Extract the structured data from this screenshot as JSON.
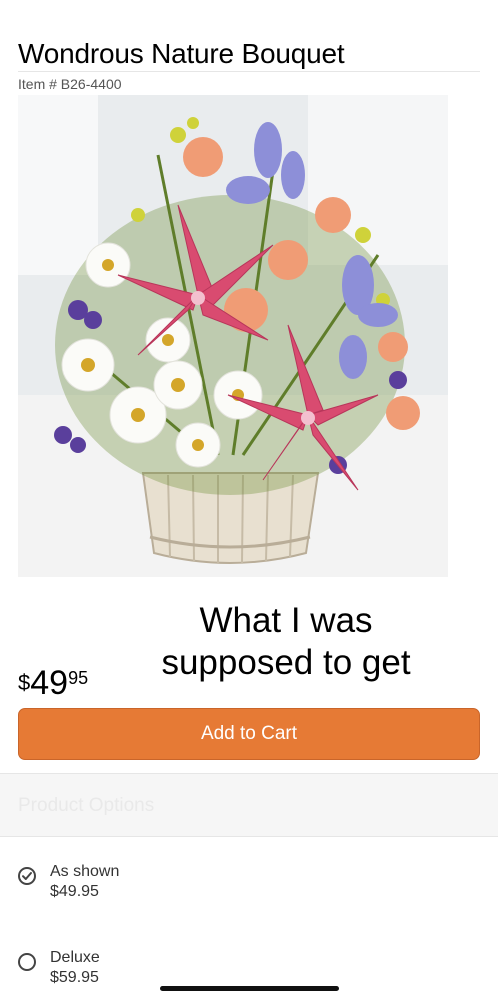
{
  "product": {
    "title": "Wondrous Nature Bouquet",
    "item_number": "Item # B26-4400",
    "image_icon": "bouquet-photo"
  },
  "overlay_caption": "What I was supposed to get",
  "price": {
    "dollar": "$",
    "whole": "49",
    "cents": "95"
  },
  "cart": {
    "add_label": "Add to Cart",
    "accent_color": "#e67a35"
  },
  "options": {
    "heading": "Product Options",
    "items": [
      {
        "name": "As shown",
        "price": "$49.95",
        "selected": true
      },
      {
        "name": "Deluxe",
        "price": "$59.95",
        "selected": false
      }
    ]
  }
}
